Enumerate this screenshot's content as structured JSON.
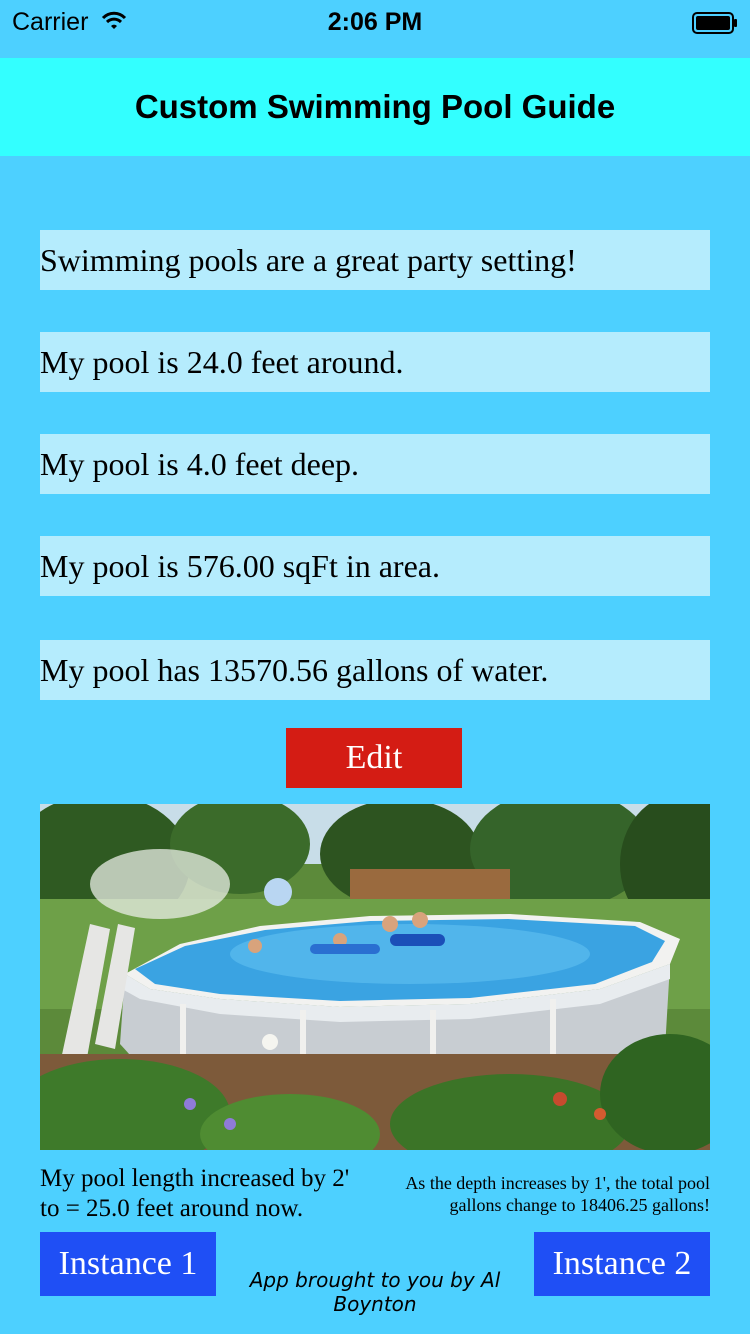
{
  "status_bar": {
    "carrier": "Carrier",
    "time": "2:06 PM"
  },
  "nav": {
    "title": "Custom Swimming Pool Guide"
  },
  "info": [
    "Swimming pools are a great party setting!",
    "My pool is 24.0 feet around.",
    "My pool is 4.0 feet deep.",
    "My pool is 576.00 sqFt in area.",
    "My pool has 13570.56 gallons of water."
  ],
  "edit_label": "Edit",
  "captions": {
    "left": "My pool length increased by 2' to = 25.0 feet around now.",
    "right": "As the depth increases by 1', the total pool gallons change to 18406.25 gallons!"
  },
  "buttons": {
    "instance1": "Instance 1",
    "instance2": "Instance 2"
  },
  "credit": "App brought to you by Al Boynton",
  "colors": {
    "background": "#4dd0ff",
    "navbar": "#33ffff",
    "info_box": "#b5ecfd",
    "edit": "#d41c14",
    "instance": "#1f4ff5"
  }
}
